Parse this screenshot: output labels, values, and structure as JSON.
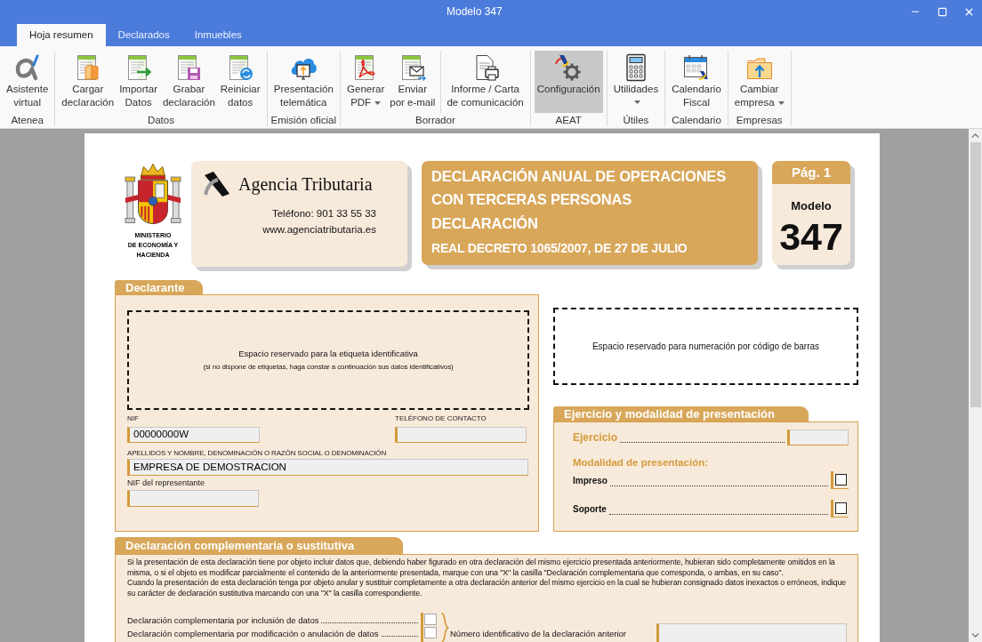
{
  "window": {
    "title": "Modelo 347"
  },
  "ribbon": {
    "tabs": [
      {
        "label": "Hoja resumen",
        "selected": true
      },
      {
        "label": "Declarados",
        "selected": false
      },
      {
        "label": "Inmuebles",
        "selected": false
      }
    ],
    "groups": [
      {
        "label": "Atenea",
        "sections": [
          {
            "buttons": [
              {
                "lines": [
                  "Asistente",
                  "virtual"
                ],
                "dropdown": false,
                "highlighted": false
              }
            ]
          }
        ]
      },
      {
        "label": "Datos",
        "sections": [
          {
            "buttons": [
              {
                "lines": [
                  "Cargar",
                  "declaración"
                ],
                "dropdown": false,
                "highlighted": false
              },
              {
                "lines": [
                  "Importar",
                  "Datos"
                ],
                "dropdown": false,
                "highlighted": false
              },
              {
                "lines": [
                  "Grabar",
                  "declaración"
                ],
                "dropdown": false,
                "highlighted": false
              },
              {
                "lines": [
                  "Reiniciar",
                  "datos"
                ],
                "dropdown": false,
                "highlighted": false
              }
            ]
          }
        ]
      },
      {
        "label": "Emisión oficial",
        "sections": [
          {
            "buttons": [
              {
                "lines": [
                  "Presentación",
                  "telemática"
                ],
                "dropdown": false,
                "highlighted": false
              }
            ]
          }
        ]
      },
      {
        "label": "Borrador",
        "sections": [
          {
            "buttons": [
              {
                "lines": [
                  "Generar",
                  "PDF"
                ],
                "dropdown": true,
                "highlighted": false
              },
              {
                "lines": [
                  "Enviar",
                  "por e-mail"
                ],
                "dropdown": false,
                "highlighted": false
              }
            ]
          },
          {
            "buttons": [
              {
                "lines": [
                  "Informe / Carta",
                  "de comunicación"
                ],
                "dropdown": false,
                "highlighted": false
              }
            ]
          }
        ]
      },
      {
        "label": "AEAT",
        "sections": [
          {
            "buttons": [
              {
                "lines": [
                  "Configuración"
                ],
                "dropdown": false,
                "highlighted": true
              }
            ]
          }
        ]
      },
      {
        "label": "Útiles",
        "sections": [
          {
            "buttons": [
              {
                "lines": [
                  "Utilidades"
                ],
                "dropdown": true,
                "highlighted": false
              }
            ]
          }
        ]
      },
      {
        "label": "Calendario",
        "sections": [
          {
            "buttons": [
              {
                "lines": [
                  "Calendario",
                  "Fiscal"
                ],
                "dropdown": false,
                "highlighted": false
              }
            ]
          }
        ]
      },
      {
        "label": "Empresas",
        "sections": [
          {
            "buttons": [
              {
                "lines": [
                  "Cambiar",
                  "empresa"
                ],
                "dropdown": true,
                "highlighted": false
              }
            ]
          }
        ]
      }
    ]
  },
  "form": {
    "ministry": {
      "lines": [
        "MINISTERIO",
        "DE ECONOMÍA Y",
        "HACIENDA"
      ]
    },
    "agency": {
      "name": "Agencia Tributaria",
      "phone": "Teléfono: 901 33 55 33",
      "web": "www.agenciatributaria.es"
    },
    "title": {
      "lines": [
        "DECLARACIÓN ANUAL DE OPERACIONES",
        "CON TERCERAS PERSONAS"
      ],
      "subtitle": "DECLARACIÓN",
      "decree": "REAL DECRETO 1065/2007, DE 27 DE JULIO"
    },
    "page_badge": {
      "page": "Pág. 1",
      "model_label": "Modelo",
      "model_number": "347"
    },
    "declarante": {
      "heading": "Declarante",
      "label_area": {
        "text": "Espacio reservado para la etiqueta identificativa",
        "note": "(si no dispone de etiquetas, haga constar a continuación sus datos identificativos)"
      },
      "nif": {
        "label": "NIF",
        "value": "00000000W"
      },
      "phone": {
        "label": "TELÉFONO DE CONTACTO"
      },
      "name": {
        "label": "APELLIDOS Y NOMBRE, DENOMINACIÓN O RAZÓN SOCIAL O DENOMINACIÓN",
        "value": "EMPRESA DE DEMOSTRACION"
      },
      "representative_nif": {
        "label": "NIF del representante"
      }
    },
    "barcode_area": {
      "text": "Espacio reservado para numeración por código de barras"
    },
    "ejercicio": {
      "heading": "Ejercicio y modalidad de presentación",
      "ejercicio_label": "Ejercicio",
      "modalidad_label": "Modalidad de presentación:",
      "options": [
        {
          "label": "Impreso",
          "checked": false
        },
        {
          "label": "Soporte",
          "checked": false
        }
      ]
    },
    "complementaria": {
      "heading": "Declaración complementaria o sustitutiva",
      "paragraphs": [
        "Si la presentación de esta declaración tiene por objeto incluir datos que, debiendo haber figurado en otra declaración del mismo ejercicio presentada anteriormente, hubieran sido completamente omitidos en la misma, o si el  objeto es modificar parcialmente el contenido de la anteriormente presentada, marque con una \"X\" la casilla \"Declaración complementaria que corresponda, o ambas, en su caso\".",
        "Cuando la presentación de esta declaración tenga por objeto anular y sustituir completamente a otra declaración anterior del mismo ejercicio en la cual se hubieran consignado datos inexactos o erróneos, indique su carácter de declaración sustitutiva marcando con una \"X\" la casilla correspondiente."
      ],
      "options": [
        {
          "label": "Declaración complementaria por inclusión de datos",
          "checked": false
        },
        {
          "label": "Declaración complementaria por modificación o anulación de datos",
          "checked": false
        }
      ],
      "previous_id_label": "Número identificativo de la declaración anterior"
    }
  }
}
